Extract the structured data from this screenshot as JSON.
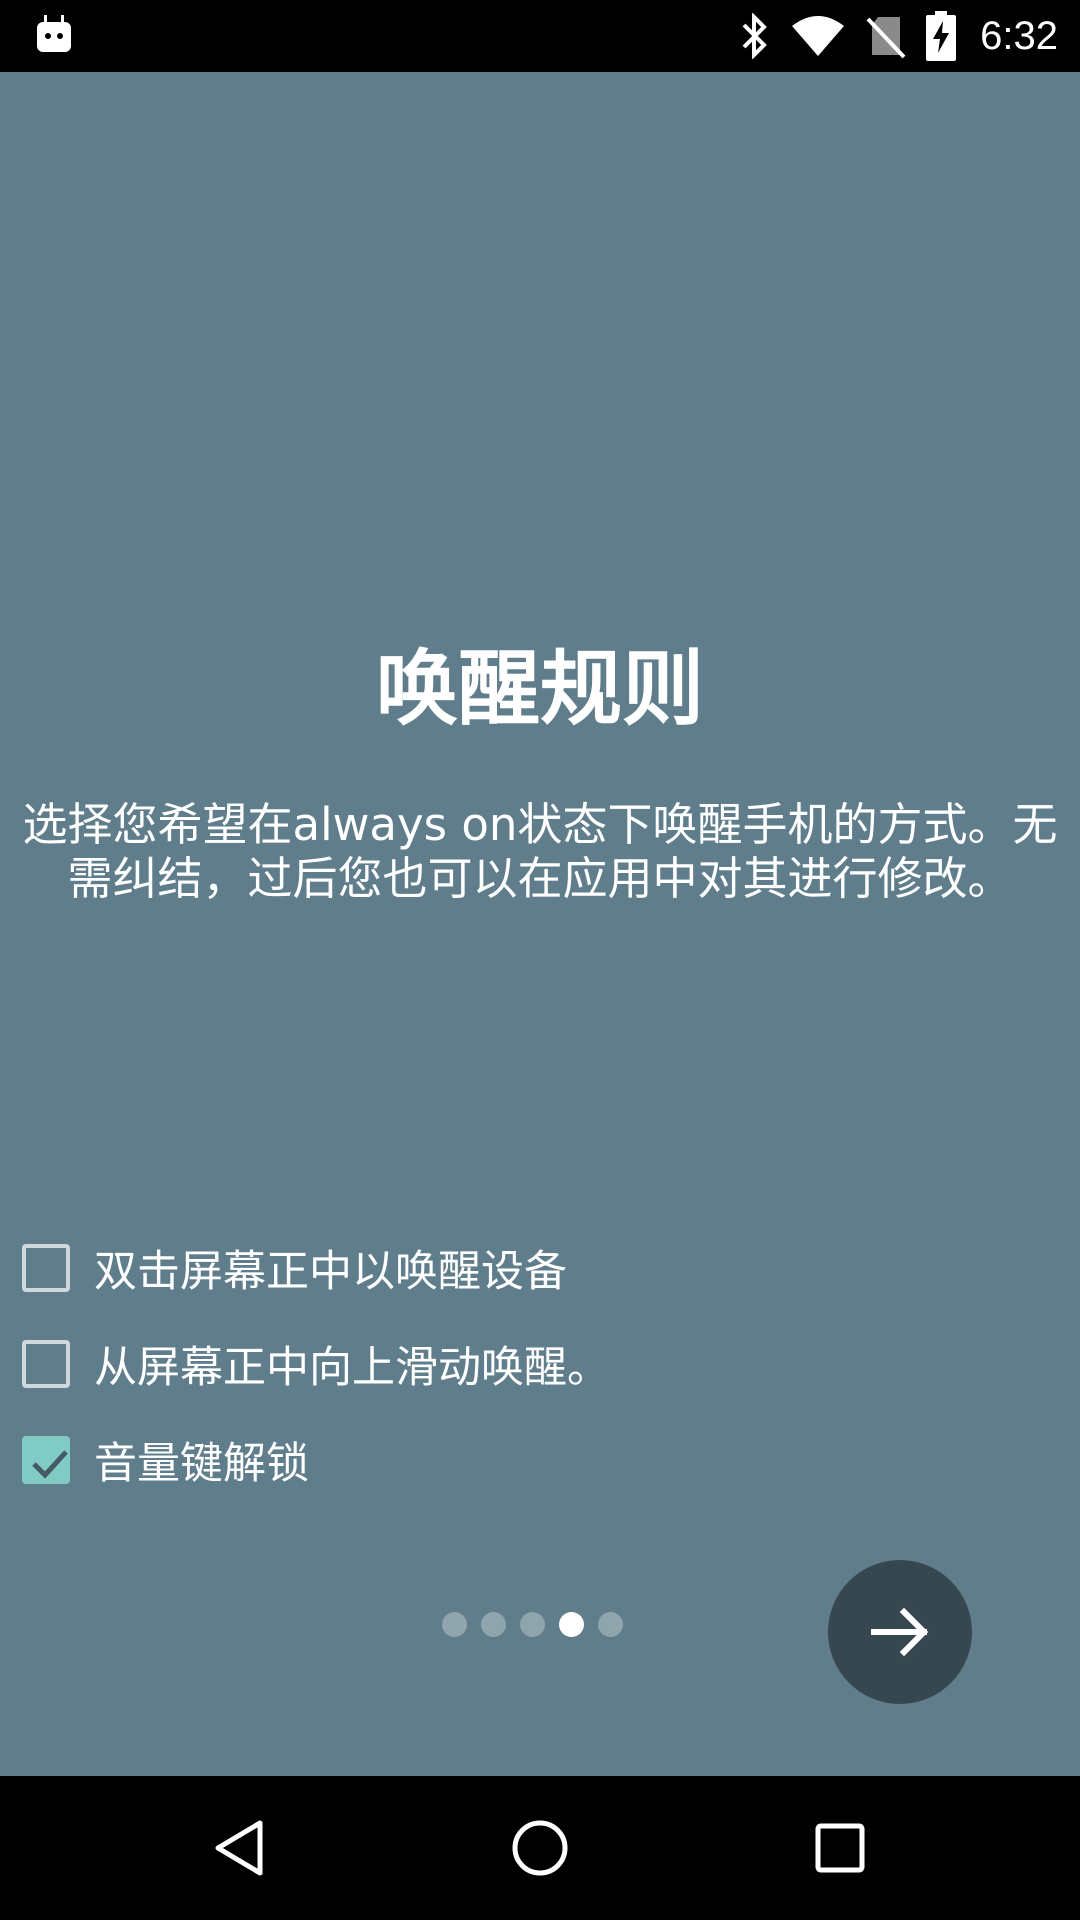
{
  "status_bar": {
    "time": "6:32",
    "icons": [
      "android-debug-icon",
      "bluetooth-icon",
      "wifi-icon",
      "no-sim-icon",
      "battery-charging-icon"
    ]
  },
  "screen": {
    "background_color": "#607d8b",
    "title": "唤醒规则",
    "description": "选择您希望在always on状态下唤醒手机的方式。无需纠结，过后您也可以在应用中对其进行修改。",
    "options": [
      {
        "label": "双击屏幕正中以唤醒设备",
        "checked": false
      },
      {
        "label": "从屏幕正中向上滑动唤醒。",
        "checked": false
      },
      {
        "label": "音量键解锁",
        "checked": true
      }
    ],
    "pager": {
      "total": 5,
      "current": 4
    },
    "next_button_icon": "arrow-right-icon"
  },
  "nav_bar": {
    "icons": [
      "back-icon",
      "home-icon",
      "recents-icon"
    ]
  }
}
